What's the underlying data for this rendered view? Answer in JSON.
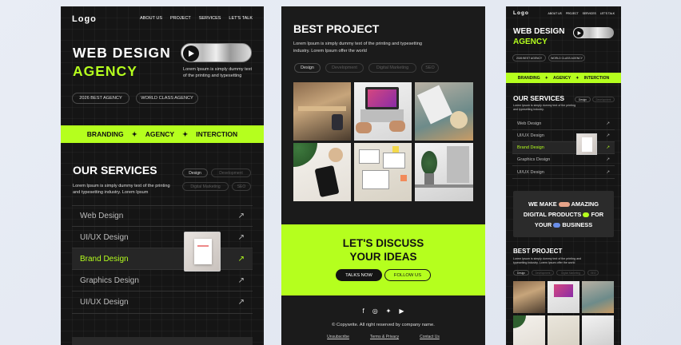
{
  "p1": {
    "logo": "Logo",
    "nav": [
      "ABOUT US",
      "PROJECT",
      "SERVICES",
      "LET'S TALK"
    ],
    "hero_line1": "WEB DESIGN",
    "hero_line2": "AGENCY",
    "hero_desc": "Lorem Ipsum is simply dummy text of the printing and typesetting",
    "badges": [
      "2026 BEST AGENCY",
      "WORLD CLASS AGENCY"
    ],
    "band": [
      "BRANDING",
      "AGENCY",
      "INTERCTION"
    ],
    "services_title": "OUR SERVICES",
    "services_desc": "Lorem Ipsum is simply dummy text of the printing and typesetting industry. Lorem Ipsum",
    "tags": [
      "Design",
      "Development",
      "Digital Marketing",
      "SEO"
    ],
    "services": [
      "Web Design",
      "UI/UX Design",
      "Brand Design",
      "Graphics Design",
      "UI/UX Design"
    ]
  },
  "p2": {
    "title": "BEST PROJECT",
    "desc": "Lorem Ipsum is simply dummy text of the printing and typesetting industry. Lorem Ipsum  offer the world",
    "tags": [
      "Design",
      "Development",
      "Digital Marketing",
      "SEO"
    ],
    "cta_line1": "LET'S DISCUSS",
    "cta_line2": "YOUR IDEAS",
    "btn_talk": "TALKS NOW",
    "btn_follow": "FOLLOW US",
    "copyright": "© Copywrite. All right reserved by company name.",
    "footer_links": [
      "Unsubscribe",
      "Terms & Privacy",
      "Contact Us"
    ]
  },
  "p3": {
    "logo": "Logo",
    "nav": [
      "ABOUT US",
      "PROJECT",
      "SERVICES",
      "LET'S TALK"
    ],
    "hero_line1": "WEB DESIGN",
    "hero_line2": "AGENCY",
    "badges": [
      "2026 BEST AGENCY",
      "WORLD CLASS AGENCY"
    ],
    "band": [
      "BRANDING",
      "AGENCY",
      "INTERCTION"
    ],
    "services_title": "OUR SERVICES",
    "services_desc": "Lorem Ipsum is simply dummy text of the printing and typesetting industry.",
    "tags": [
      "Design",
      "Development"
    ],
    "services": [
      "Web Design",
      "UI/UX Design",
      "Brand Design",
      "Graphics Design",
      "UI/UX Design"
    ],
    "digital_line1": "WE MAKE",
    "digital_line1b": "AMAZING",
    "digital_line2": "DIGITAL PRODUCTS",
    "digital_line2b": "FOR",
    "digital_line3": "YOUR",
    "digital_line3b": "BUSINESS",
    "project_title": "BEST PROJECT",
    "project_desc": "Lorem Ipsum is simply dummy text of the printing and typesetting industry. Lorem Ipsum  offer the world",
    "tags2": [
      "Design",
      "Development",
      "Digital Marketing",
      "SEO"
    ]
  },
  "colors": {
    "accent": "#b5ff1e",
    "panel": "#151515"
  }
}
